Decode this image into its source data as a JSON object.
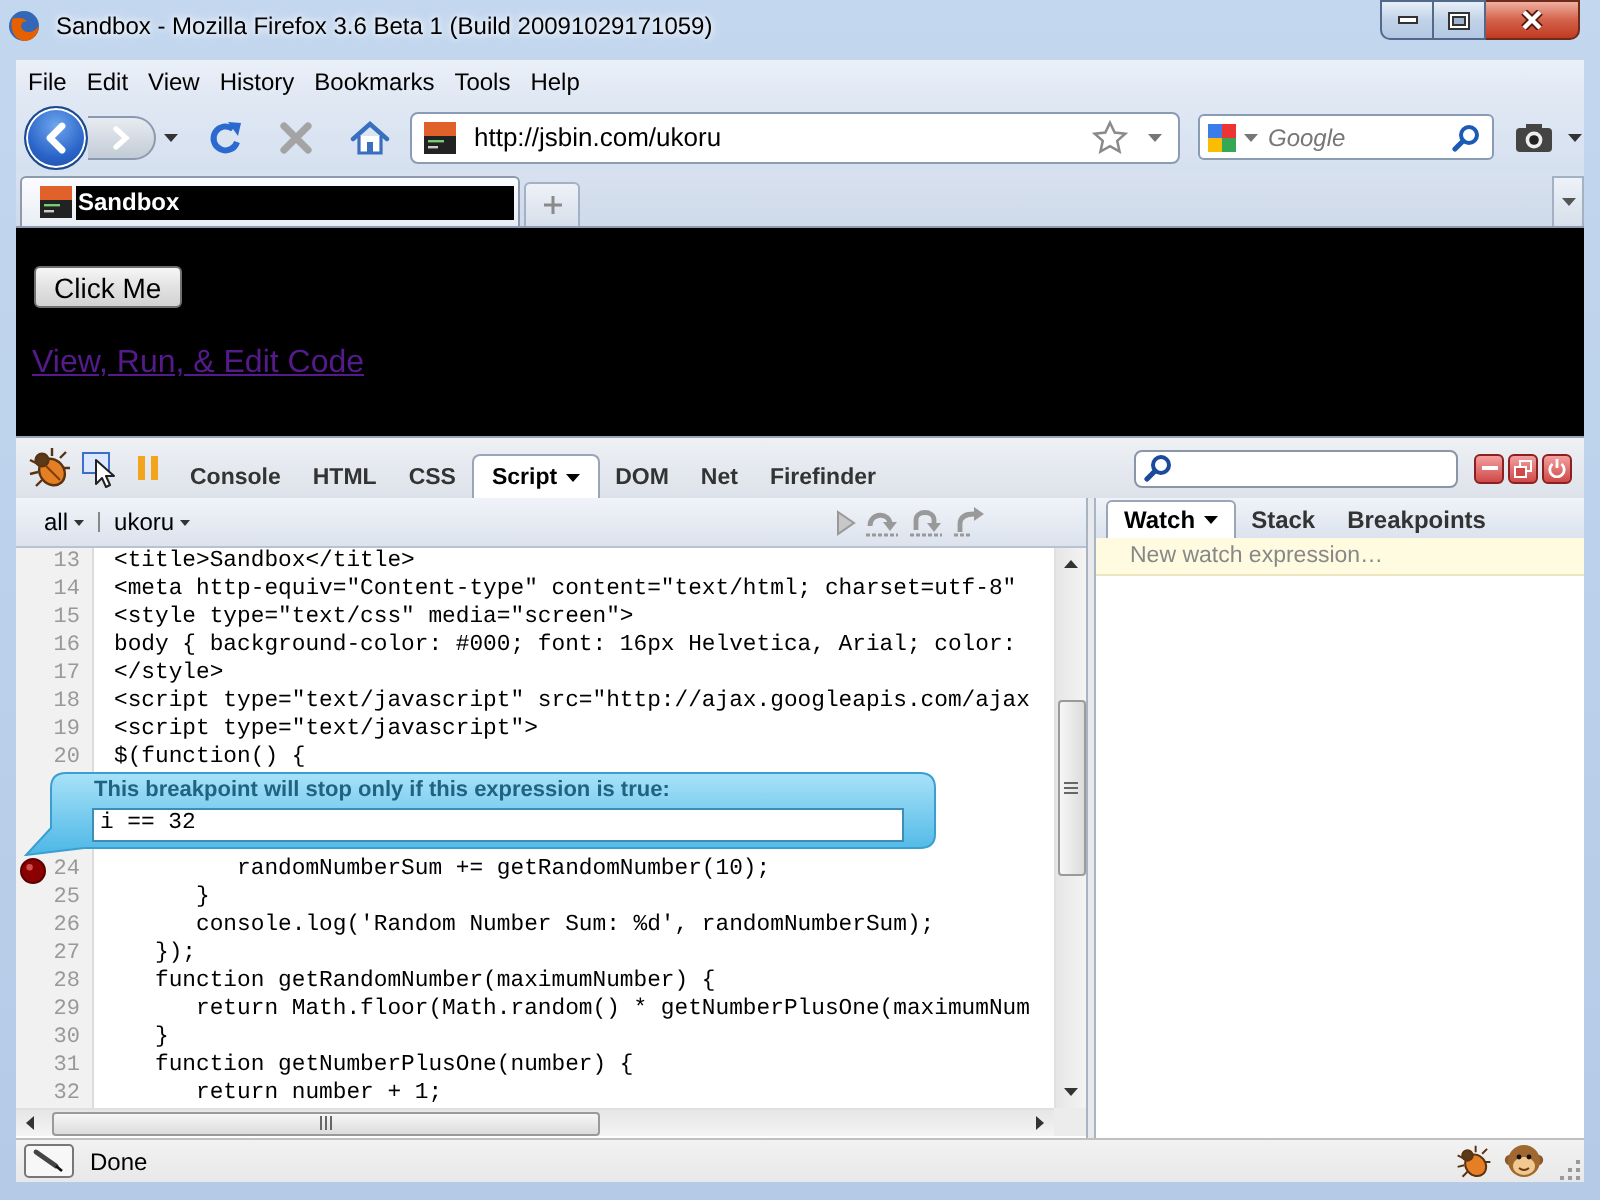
{
  "window": {
    "title": "Sandbox - Mozilla Firefox 3.6 Beta 1 (Build 20091029171059)"
  },
  "menu_bar": [
    "File",
    "Edit",
    "View",
    "History",
    "Bookmarks",
    "Tools",
    "Help"
  ],
  "nav_bar": {
    "back": {
      "disabled": false
    },
    "forward": {
      "disabled": true
    },
    "stop": {
      "disabled": true
    },
    "url": "http://jsbin.com/ukoru",
    "search": {
      "placeholder": "Google"
    }
  },
  "tabs": [
    {
      "title": "Sandbox",
      "selected": true
    }
  ],
  "page": {
    "button": "Click Me",
    "link": "View, Run, & Edit Code"
  },
  "firebug": {
    "tabs": [
      {
        "label": "Console",
        "selected": false,
        "menu": false
      },
      {
        "label": "HTML",
        "selected": false,
        "menu": false
      },
      {
        "label": "CSS",
        "selected": false,
        "menu": false
      },
      {
        "label": "Script",
        "selected": true,
        "menu": true
      },
      {
        "label": "DOM",
        "selected": false,
        "menu": false
      },
      {
        "label": "Net",
        "selected": false,
        "menu": false
      },
      {
        "label": "Firefinder",
        "selected": false,
        "menu": false
      }
    ],
    "script_toolbar": {
      "filter": "all",
      "file": "ukoru",
      "debug_buttons": [
        {
          "kind": "continue",
          "disabled": true
        },
        {
          "kind": "step-over",
          "disabled": true
        },
        {
          "kind": "step-into",
          "disabled": true
        },
        {
          "kind": "step-out",
          "disabled": true
        }
      ]
    },
    "code_lines": [
      {
        "number": "13",
        "text": "<title>Sandbox</title>",
        "breakpoint": false
      },
      {
        "number": "14",
        "text": "<meta http-equiv=\"Content-type\" content=\"text/html; charset=utf-8\"",
        "breakpoint": false
      },
      {
        "number": "15",
        "text": "<style type=\"text/css\" media=\"screen\">",
        "breakpoint": false
      },
      {
        "number": "16",
        "text": "body { background-color: #000; font: 16px Helvetica, Arial; color:",
        "breakpoint": false
      },
      {
        "number": "17",
        "text": "</style>",
        "breakpoint": false
      },
      {
        "number": "18",
        "text": "<script type=\"text/javascript\" src=\"http://ajax.googleapis.com/ajax",
        "breakpoint": false
      },
      {
        "number": "19",
        "text": "<script type=\"text/javascript\">",
        "breakpoint": false
      },
      {
        "number": "20",
        "text": "$(function() {",
        "breakpoint": false
      },
      {
        "number": "24",
        "text": "         randomNumberSum += getRandomNumber(10);",
        "breakpoint": true,
        "condition": {
          "label": "This breakpoint will stop only if this expression is true:",
          "expression": "i == 32"
        }
      },
      {
        "number": "25",
        "text": "      }",
        "breakpoint": false
      },
      {
        "number": "26",
        "text": "      console.log('Random Number Sum: %d', randomNumberSum);",
        "breakpoint": false
      },
      {
        "number": "27",
        "text": "   });",
        "breakpoint": false
      },
      {
        "number": "28",
        "text": "   function getRandomNumber(maximumNumber) {",
        "breakpoint": false
      },
      {
        "number": "29",
        "text": "      return Math.floor(Math.random() * getNumberPlusOne(maximumNum",
        "breakpoint": false
      },
      {
        "number": "30",
        "text": "   }",
        "breakpoint": false
      },
      {
        "number": "31",
        "text": "   function getNumberPlusOne(number) {",
        "breakpoint": false
      },
      {
        "number": "32",
        "text": "      return number + 1;",
        "breakpoint": false
      }
    ],
    "side_panel": {
      "tabs": [
        {
          "label": "Watch",
          "selected": true,
          "menu": true
        },
        {
          "label": "Stack",
          "selected": false,
          "menu": false
        },
        {
          "label": "Breakpoints",
          "selected": false,
          "menu": false
        }
      ],
      "watch_placeholder": "New watch expression…"
    }
  },
  "status_bar": {
    "text": "Done"
  }
}
